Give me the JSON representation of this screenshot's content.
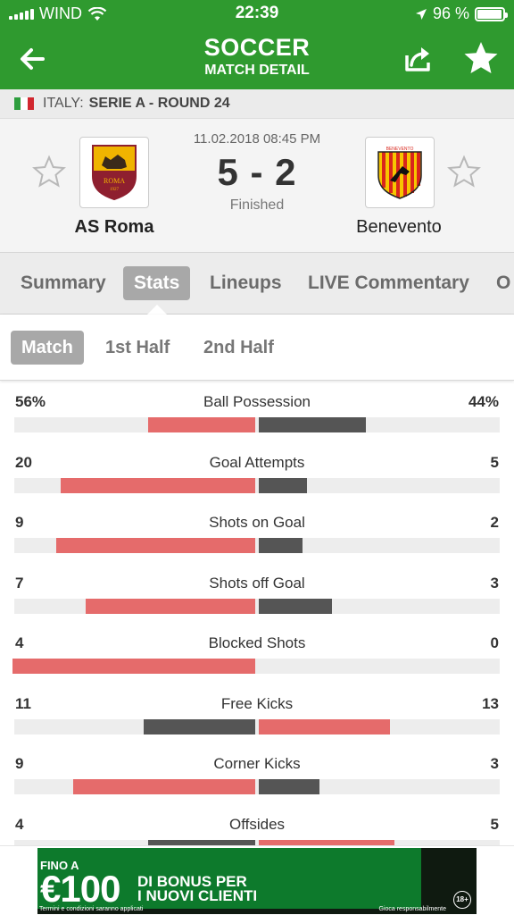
{
  "status_bar": {
    "carrier": "WIND",
    "time": "22:39",
    "battery_pct": "96 %",
    "battery_level": 0.96
  },
  "header": {
    "title": "SOCCER",
    "subtitle": "MATCH DETAIL"
  },
  "league": {
    "label": "ITALY:",
    "name": "SERIE A - ROUND 24",
    "flag_colors": [
      "#2e9e3e",
      "#ffffff",
      "#d1272f"
    ]
  },
  "match": {
    "datetime": "11.02.2018 08:45 PM",
    "score": "5 - 2",
    "status": "Finished",
    "home": {
      "name": "AS Roma",
      "logo_text": "ROMA",
      "logo_year": "1927",
      "colors": [
        "#8e1f2f",
        "#f0b400"
      ]
    },
    "away": {
      "name": "Benevento",
      "logo_text": "BENEVENTO",
      "colors": [
        "#d9261c",
        "#f7c600"
      ]
    }
  },
  "tabs": [
    {
      "label": "Summary",
      "active": false
    },
    {
      "label": "Stats",
      "active": true
    },
    {
      "label": "Lineups",
      "active": false
    },
    {
      "label": "LIVE Commentary",
      "active": false
    },
    {
      "label": "O",
      "active": false
    }
  ],
  "subtabs": [
    {
      "label": "Match",
      "active": true
    },
    {
      "label": "1st Half",
      "active": false
    },
    {
      "label": "2nd Half",
      "active": false
    }
  ],
  "colors": {
    "green": "#2f9a2f",
    "home_bar_win": "#e56b6b",
    "away_bar_lose": "#555555"
  },
  "stats": [
    {
      "label": "Ball Possession",
      "home": "56%",
      "away": "44%",
      "home_pct": 0.44,
      "away_pct": 0.44,
      "winner": "home"
    },
    {
      "label": "Goal Attempts",
      "home": "20",
      "away": "5",
      "home_pct": 0.8,
      "away_pct": 0.2,
      "winner": "home"
    },
    {
      "label": "Shots on Goal",
      "home": "9",
      "away": "2",
      "home_pct": 0.82,
      "away_pct": 0.18,
      "winner": "home"
    },
    {
      "label": "Shots off Goal",
      "home": "7",
      "away": "3",
      "home_pct": 0.7,
      "away_pct": 0.3,
      "winner": "home"
    },
    {
      "label": "Blocked Shots",
      "home": "4",
      "away": "0",
      "home_pct": 1.0,
      "away_pct": 0.0,
      "winner": "home"
    },
    {
      "label": "Free Kicks",
      "home": "11",
      "away": "13",
      "home_pct": 0.46,
      "away_pct": 0.54,
      "winner": "away"
    },
    {
      "label": "Corner Kicks",
      "home": "9",
      "away": "3",
      "home_pct": 0.75,
      "away_pct": 0.25,
      "winner": "home"
    },
    {
      "label": "Offsides",
      "home": "4",
      "away": "5",
      "home_pct": 0.44,
      "away_pct": 0.56,
      "winner": "away"
    }
  ],
  "ad": {
    "line1": "FINO A",
    "amount": "€100",
    "bonus_line1": "DI BONUS PER",
    "bonus_line2": "I NUOVI CLIENTI",
    "fine_print": "Termini e condizioni saranno applicati",
    "responsible": "Gioca responsabilmente",
    "age": "18+"
  }
}
